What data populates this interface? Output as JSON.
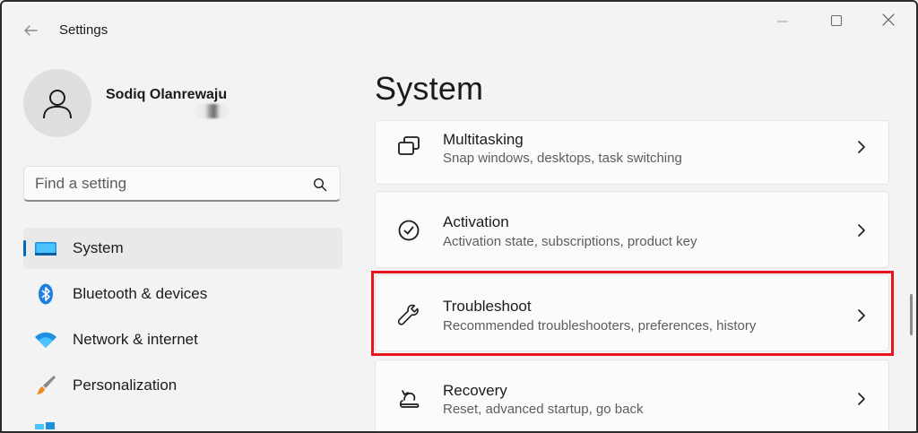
{
  "window": {
    "title": "Settings"
  },
  "profile": {
    "name": "Sodiq Olanrewaju"
  },
  "search": {
    "placeholder": "Find a setting"
  },
  "sidebar": {
    "items": [
      {
        "label": "System",
        "icon": "system-display-icon",
        "selected": true
      },
      {
        "label": "Bluetooth & devices",
        "icon": "bluetooth-icon",
        "selected": false
      },
      {
        "label": "Network & internet",
        "icon": "wifi-icon",
        "selected": false
      },
      {
        "label": "Personalization",
        "icon": "paintbrush-icon",
        "selected": false
      }
    ]
  },
  "main": {
    "title": "System",
    "cards": [
      {
        "title": "Multitasking",
        "description": "Snap windows, desktops, task switching",
        "icon": "multitasking-icon"
      },
      {
        "title": "Activation",
        "description": "Activation state, subscriptions, product key",
        "icon": "activation-check-icon"
      },
      {
        "title": "Troubleshoot",
        "description": "Recommended troubleshooters, preferences, history",
        "icon": "wrench-icon",
        "highlighted": true
      },
      {
        "title": "Recovery",
        "description": "Reset, advanced startup, go back",
        "icon": "recovery-icon"
      }
    ]
  },
  "colors": {
    "accent": "#0067c0",
    "highlight": "#e8141e",
    "background": "#f3f3f3",
    "card": "#fbfbfb"
  }
}
